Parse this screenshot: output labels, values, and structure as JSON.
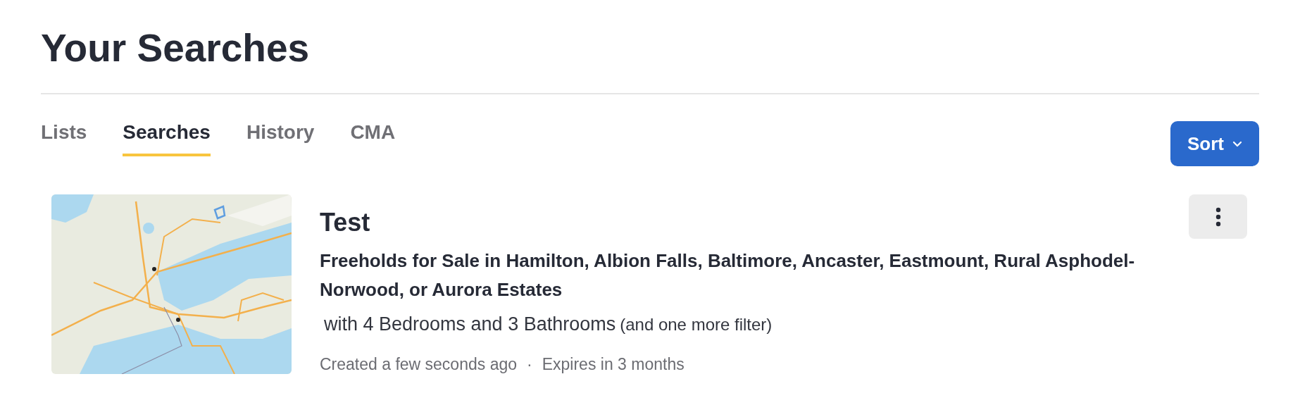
{
  "page_title": "Your Searches",
  "tabs": [
    {
      "label": "Lists",
      "selected": false
    },
    {
      "label": "Searches",
      "selected": true
    },
    {
      "label": "History",
      "selected": false
    },
    {
      "label": "CMA",
      "selected": false
    }
  ],
  "sort_button": {
    "label": "Sort"
  },
  "searches": [
    {
      "name": "Test",
      "description": "Freeholds for Sale in Hamilton, Albion Falls, Baltimore, Ancaster, Eastmount, Rural Asphodel-Norwood, or Aurora Estates",
      "filters": "with 4 Bedrooms and 3 Bathrooms",
      "more_filters": "(and one more filter)",
      "created": "Created a few seconds ago",
      "separator": "·",
      "expires": "Expires in 3 months"
    }
  ]
}
